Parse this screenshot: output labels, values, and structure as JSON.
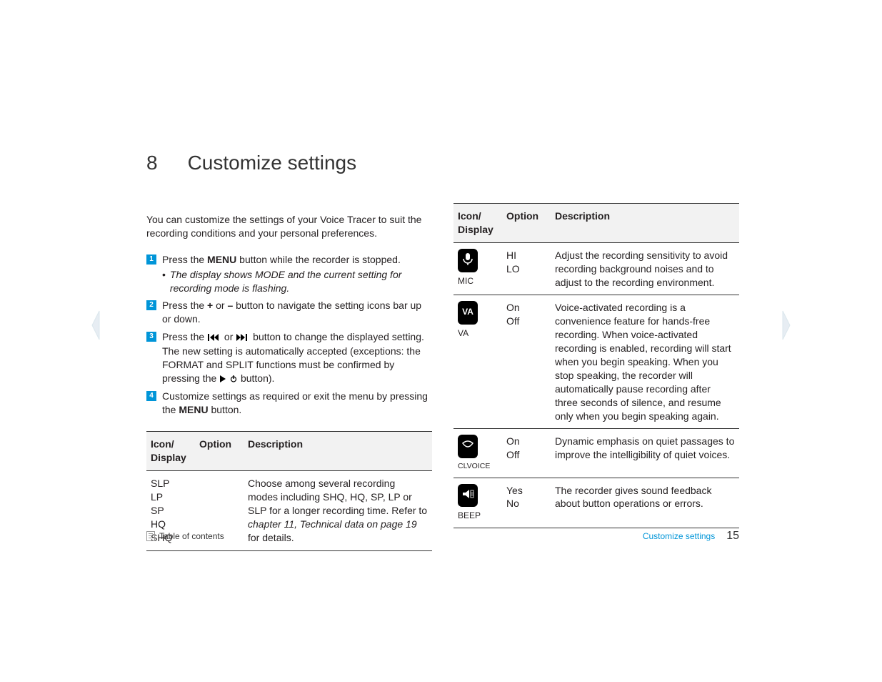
{
  "chapter": {
    "number": "8",
    "title": "Customize settings"
  },
  "intro": "You can customize the settings of your Voice Tracer to suit the recording conditions and your personal preferences.",
  "steps": [
    {
      "n": "1",
      "text_pre": "Press the ",
      "bold": "MENU",
      "text_post": " button while the recorder is stopped.",
      "sub": "The display shows MODE and the current setting for recording mode is flashing."
    },
    {
      "n": "2",
      "text_pre": "Press the ",
      "bold": "+",
      "mid": " or ",
      "bold2": "–",
      "text_post": " button to navigate the setting icons bar up or down."
    },
    {
      "n": "3",
      "text_pre": "Press the ",
      "icons": true,
      "text_post": " button to change the displayed setting. The new setting is automatically accepted (exceptions: the FORMAT and SPLIT functions must be confirmed by pressing the ",
      "tail_icons": true,
      "tail_post": " button)."
    },
    {
      "n": "4",
      "text_pre": "Customize settings as required or exit the menu by pressing the ",
      "bold": "MENU",
      "text_post": " button."
    }
  ],
  "table_headers": {
    "icon": "Icon/\nDisplay",
    "option": "Option",
    "desc": "Description"
  },
  "left_table": [
    {
      "icon_label": "",
      "options": [
        "SLP",
        "LP",
        "SP",
        "HQ",
        "SHQ"
      ],
      "desc_pre": "Choose among several recording modes including SHQ, HQ, SP, LP or SLP for a longer recording time. Refer to ",
      "desc_ref": "chapter 11, Technical data on page 19",
      "desc_post": "  for details."
    }
  ],
  "right_table": [
    {
      "icon_id": "mic-icon",
      "icon_label": "MIC",
      "options": [
        "HI",
        "LO"
      ],
      "desc": "Adjust the recording sensitivity to avoid recording background noises and to adjust to the recording environment."
    },
    {
      "icon_id": "va-icon",
      "icon_label": "VA",
      "options": [
        "On",
        "Off"
      ],
      "desc": "Voice-activated recording is a convenience feature for hands-free recording. When voice-activated recording is enabled, recording will start when you begin speaking. When you stop speaking, the recorder will automatically pause recording after three seconds of silence, and resume only when you begin speaking again."
    },
    {
      "icon_id": "clvoice-icon",
      "icon_label": "CLVOICE",
      "options": [
        "On",
        "Off"
      ],
      "desc": "Dynamic emphasis on quiet passages to improve the intelligibility of quiet voices."
    },
    {
      "icon_id": "beep-icon",
      "icon_label": "BEEP",
      "options": [
        "Yes",
        "No"
      ],
      "desc": "The recorder gives sound feedback about button operations or errors."
    }
  ],
  "footer": {
    "toc": "Table of contents",
    "section": "Customize settings",
    "page": "15"
  }
}
